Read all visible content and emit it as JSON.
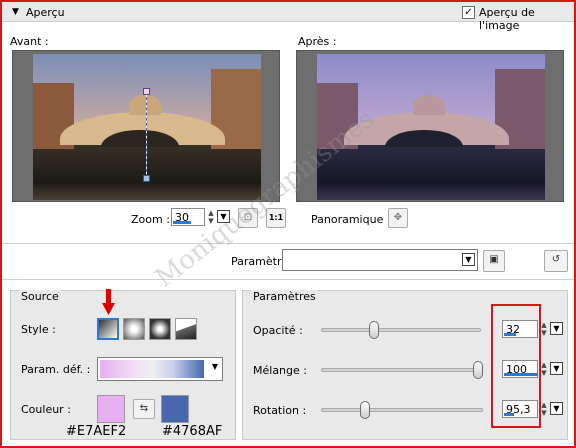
{
  "header": {
    "title": "Aperçu",
    "preview_checkbox_label": "Aperçu de l'image",
    "preview_checked": true
  },
  "before": {
    "label": "Avant :"
  },
  "after": {
    "label": "Après :"
  },
  "zoom": {
    "label": "Zoom :",
    "value": "30"
  },
  "panoramique": {
    "label": "Panoramique :"
  },
  "params": {
    "label": "Paramètres",
    "value": ""
  },
  "source": {
    "title": "Source",
    "style_label": "Style :",
    "param_def_label": "Param. déf. :",
    "couleur_label": "Couleur :",
    "color1": "#E7AEF2",
    "color2": "#4768AF",
    "color1_label": "#E7AEF2",
    "color2_label": "#4768AF"
  },
  "parametres": {
    "title": "Paramètres",
    "sliders": [
      {
        "label": "Opacité :",
        "value": "32",
        "fraction": 0.32
      },
      {
        "label": "Mélange :",
        "value": "100",
        "fraction": 1.0
      },
      {
        "label": "Rotation :",
        "value": "95,3",
        "fraction": 0.26
      }
    ]
  },
  "watermark": "Moniquegraphismes"
}
